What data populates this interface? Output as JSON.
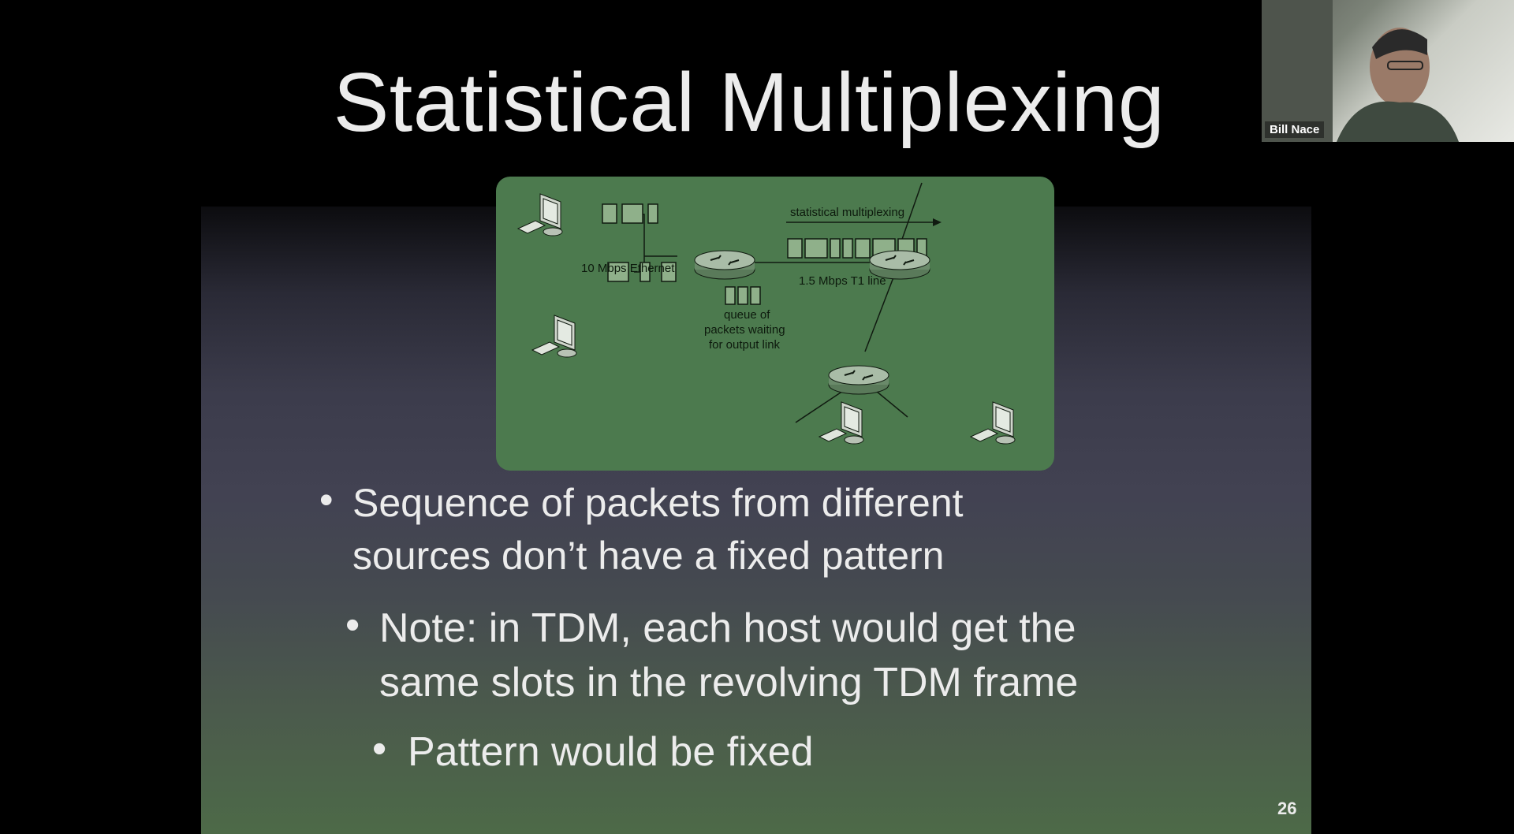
{
  "slide": {
    "title": "Statistical Multiplexing",
    "page_number": "26",
    "bullets": [
      {
        "level": 1,
        "lines": [
          "Sequence of packets from different",
          "sources don’t have a fixed pattern"
        ]
      },
      {
        "level": 2,
        "lines": [
          "Note: in TDM, each host would get the",
          "same slots in the revolving TDM frame"
        ]
      },
      {
        "level": 3,
        "lines": [
          "Pattern would be fixed"
        ]
      }
    ],
    "bullet_symbol": "•"
  },
  "diagram": {
    "label_ethernet": "10 Mbps Ethernet",
    "label_stat_mux": "statistical multiplexing",
    "label_t1": "1.5 Mbps T1 line",
    "label_queue_1": "queue of",
    "label_queue_2": "packets waiting",
    "label_queue_3": "for output link",
    "colors": {
      "panel": "#4c7a4e",
      "packet": "#8fb08a",
      "line": "#101a10"
    }
  },
  "presenter": {
    "name": "Bill Nace"
  }
}
